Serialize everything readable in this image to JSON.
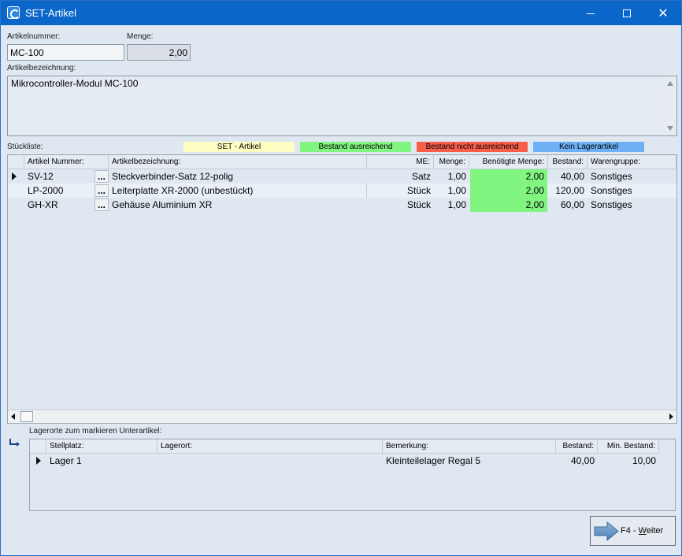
{
  "window": {
    "title": "SET-Artikel",
    "minimize": "minimize",
    "maximize": "maximize",
    "close": "✕"
  },
  "artikelnummer": {
    "label": "Artikelnummer:",
    "value": "MC-100"
  },
  "menge": {
    "label": "Menge:",
    "value": "2,00"
  },
  "bezeichnung": {
    "label": "Artikelbezeichnung:",
    "value": "Mikrocontroller-Modul MC-100"
  },
  "stueckliste": {
    "label": "Stückliste:",
    "legend": [
      {
        "label": "SET - Artikel",
        "color": "#fefec2"
      },
      {
        "label": "Bestand ausreichend",
        "color": "#80f57f"
      },
      {
        "label": "Bestand nicht ausreichend",
        "color": "#f95e4b"
      },
      {
        "label": "Kein Lagerartikel",
        "color": "#6eb0f6"
      }
    ],
    "columns": {
      "nummer": "Artikel Nummer:",
      "bezeichnung": "Artikelbezeichnung:",
      "me": "ME:",
      "menge": "Menge:",
      "benoetigt": "Benötigte Menge:",
      "bestand": "Bestand:",
      "warengruppe": "Warengruppe:"
    },
    "rows": [
      {
        "nummer": "SV-12",
        "dots": "...",
        "bezeichnung": "Steckverbinder-Satz 12-polig",
        "me": "Satz",
        "menge": "1,00",
        "benoetigt": "2,00",
        "bestand": "40,00",
        "warengruppe": "Sonstiges"
      },
      {
        "nummer": "LP-2000",
        "dots": "...",
        "bezeichnung": "Leiterplatte XR-2000 (unbestückt)",
        "me": "Stück",
        "menge": "1,00",
        "benoetigt": "2,00",
        "bestand": "120,00",
        "warengruppe": "Sonstiges"
      },
      {
        "nummer": "GH-XR",
        "dots": "...",
        "bezeichnung": "Gehäuse Aluminium XR",
        "me": "Stück",
        "menge": "1,00",
        "benoetigt": "2,00",
        "bestand": "60,00",
        "warengruppe": "Sonstiges"
      }
    ]
  },
  "lagerorte": {
    "label": "Lagerorte zum markieren Unterartikel:",
    "columns": {
      "stellplatz": "Stellplatz:",
      "lagerort": "Lagerort:",
      "bemerkung": "Bemerkung:",
      "bestand": "Bestand:",
      "min_bestand": "Min. Bestand:"
    },
    "rows": [
      {
        "stellplatz": "Lager 1",
        "lagerort": "",
        "bemerkung": "Kleinteilelager Regal 5",
        "bestand": "40,00",
        "min_bestand": "10,00"
      }
    ]
  },
  "weiter_button": {
    "prefix": "F4 - ",
    "underlined": "W",
    "rest": "eiter"
  }
}
